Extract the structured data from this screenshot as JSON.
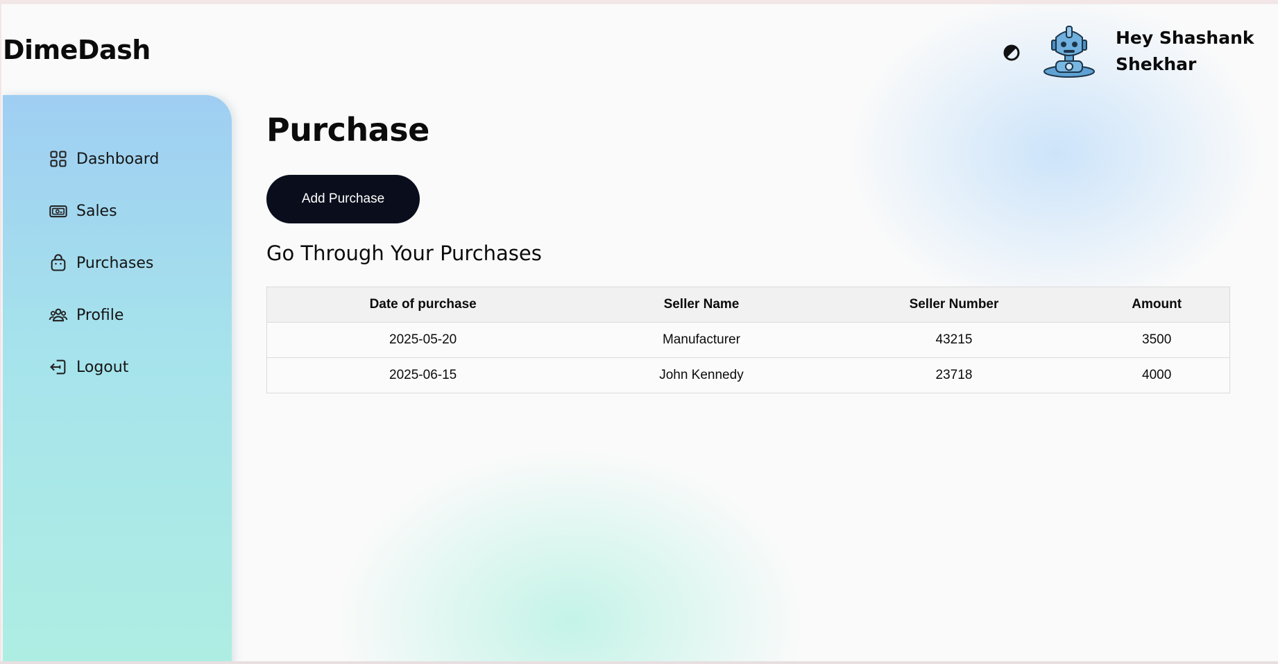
{
  "brand": {
    "name": "DimeDash"
  },
  "header": {
    "theme_toggle_icon": "contrast-icon",
    "avatar_icon": "robot-avatar-icon",
    "greeting": "Hey Shashank Shekhar"
  },
  "sidebar": {
    "items": [
      {
        "label": "Dashboard",
        "icon": "grid-icon"
      },
      {
        "label": "Sales",
        "icon": "money-icon"
      },
      {
        "label": "Purchases",
        "icon": "shopping-bag-icon"
      },
      {
        "label": "Profile",
        "icon": "users-icon"
      },
      {
        "label": "Logout",
        "icon": "logout-icon"
      }
    ]
  },
  "main": {
    "title": "Purchase",
    "add_button_label": "Add Purchase",
    "section_heading": "Go Through Your Purchases",
    "table": {
      "columns": [
        "Date of purchase",
        "Seller Name",
        "Seller Number",
        "Amount"
      ],
      "rows": [
        [
          "2025-05-20",
          "Manufacturer",
          "43215",
          "3500"
        ],
        [
          "2025-06-15",
          "John Kennedy",
          "23718",
          "4000"
        ]
      ]
    }
  },
  "colors": {
    "button_bg": "#0a0e1c",
    "sidebar_top": "#9fcef2",
    "sidebar_bottom": "#aeeee2"
  }
}
